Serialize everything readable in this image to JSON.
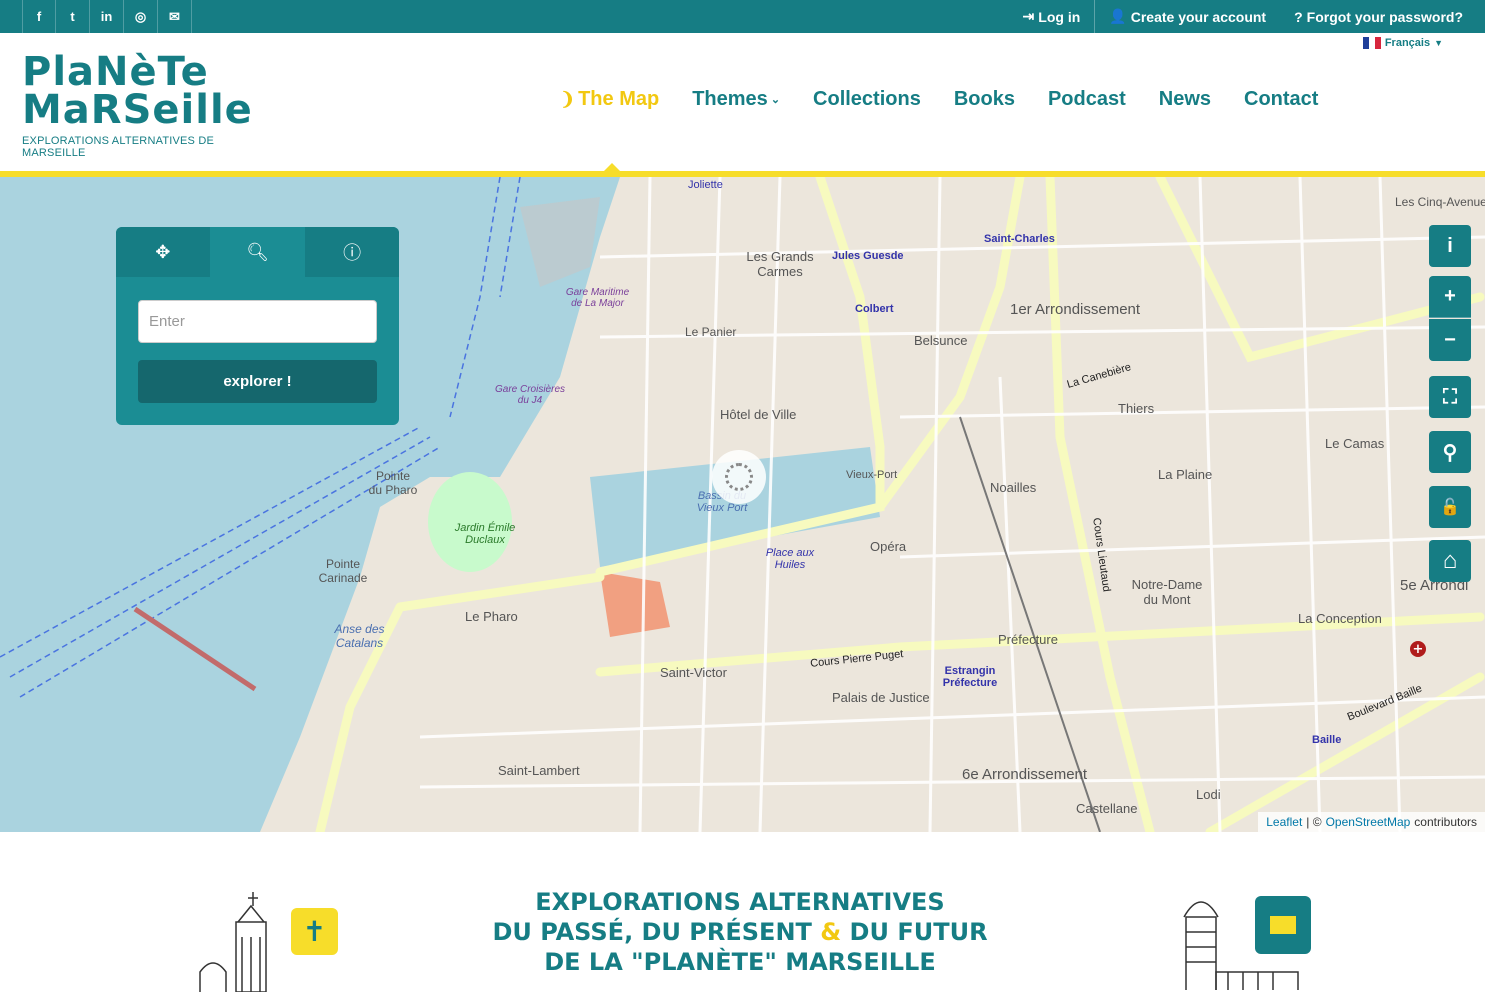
{
  "topbar": {
    "social": [
      {
        "icon": "facebook-icon",
        "glyph": "f"
      },
      {
        "icon": "twitter-icon",
        "glyph": "t"
      },
      {
        "icon": "linkedin-icon",
        "glyph": "in"
      },
      {
        "icon": "instagram-icon",
        "glyph": "◎"
      },
      {
        "icon": "envelope-icon",
        "glyph": "✉"
      }
    ],
    "login_label": "Log in",
    "create_account_label": "Create your account",
    "forgot_password_label": "Forgot your password?"
  },
  "header": {
    "logo_line1": "PlaNèTe",
    "logo_line2": "MaRSeille",
    "logo_line3": "EXPLORATIONS ALTERNATIVES DE MARSEILLE",
    "language": "Français",
    "nav": [
      {
        "label": "The Map"
      },
      {
        "label": "Themes"
      },
      {
        "label": "Collections"
      },
      {
        "label": "Books"
      },
      {
        "label": "Podcast"
      },
      {
        "label": "News"
      },
      {
        "label": "Contact"
      }
    ]
  },
  "search_panel": {
    "tab_move_icon": "move-icon",
    "tab_search_icon": "search-zoom-icon",
    "tab_info_icon": "info-icon",
    "input_placeholder": "Enter",
    "button_label": "explorer !"
  },
  "map": {
    "controls": [
      {
        "icon": "info-icon",
        "glyph": "i"
      },
      {
        "icon": "zoom-in-icon",
        "glyph": "+"
      },
      {
        "icon": "zoom-out-icon",
        "glyph": "−"
      },
      {
        "icon": "fullscreen-icon",
        "glyph": "⛶"
      },
      {
        "icon": "location-pin-icon",
        "glyph": "⚲"
      },
      {
        "icon": "unlock-icon",
        "glyph": "🔓"
      },
      {
        "icon": "home-icon",
        "glyph": "⌂"
      }
    ],
    "attribution": {
      "leaflet": "Leaflet",
      "sep": "| ©",
      "osm": "OpenStreetMap",
      "suffix": "contributors"
    },
    "labels": [
      "Joliette",
      "Les Grands Carmes",
      "Jules Guesde",
      "Saint-Charles",
      "1er Arrondissement",
      "Le Panier",
      "Colbert",
      "Belsunce",
      "Hôtel de Ville",
      "Vieux-Port",
      "Noailles",
      "Thiers",
      "La Plaine",
      "Le Camas",
      "Pointe du Pharo",
      "Jardin Émile Duclaux",
      "Bassin du Vieux Port",
      "Place aux Huiles",
      "Opéra",
      "Pointe Carinade",
      "Anse des Catalans",
      "Le Pharo",
      "Saint-Victor",
      "Palais de Justice",
      "Estrangin Préfecture",
      "Préfecture",
      "Notre-Dame du Mont",
      "La Conception",
      "6e Arrondissement",
      "Saint-Lambert",
      "Castellane",
      "Lodi",
      "Baille",
      "Cours Pierre Puget",
      "Boulevard Baille",
      "Gare Maritime de La Major",
      "Gare Croisières du J4",
      "Les Cinq-Avenues",
      "Cours Lieutaud",
      "La Canebière",
      "5e Arrondi"
    ]
  },
  "bottom": {
    "tagline_line1": "EXPLORATIONS ALTERNATIVES",
    "tagline_line2a": "DU PASSÉ, DU PRÉSENT ",
    "tagline_amp": "&",
    "tagline_line2b": " DU FUTUR",
    "tagline_line3": "DE LA \"PLANÈTE\" MARSEILLE"
  },
  "colors": {
    "primary": "#167d84",
    "accent": "#f2c811",
    "yellow": "#f7dd2a"
  }
}
